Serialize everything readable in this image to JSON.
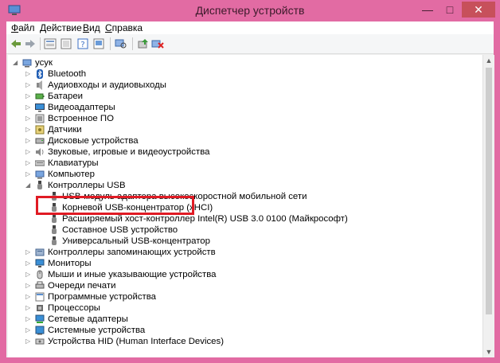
{
  "window": {
    "title": "Диспетчер устройств",
    "minimize": "—",
    "maximize": "□",
    "close": "✕"
  },
  "menu": [
    {
      "accel": "Ф",
      "rest": "айл"
    },
    {
      "accel": "Д",
      "rest": "ействие"
    },
    {
      "accel": "В",
      "rest": "ид"
    },
    {
      "accel": "С",
      "rest": "правка"
    }
  ],
  "toolbar": [
    "back-icon",
    "forward-icon",
    "properties-view-icon",
    "help-icon",
    "properties-icon",
    "monitor-icon",
    "scan-hardware-icon",
    "update-driver-icon",
    "remove-device-icon"
  ],
  "tree": {
    "root": "усук",
    "categories": [
      "Bluetooth",
      "Аудиовходы и аудиовыходы",
      "Батареи",
      "Видеоадаптеры",
      "Встроенное ПО",
      "Датчики",
      "Дисковые устройства",
      "Звуковые, игровые и видеоустройства",
      "Клавиатуры",
      "Компьютер",
      "Контроллеры USB",
      "Контроллеры запоминающих устройств",
      "Мониторы",
      "Мыши и иные указывающие устройства",
      "Очереди печати",
      "Программные устройства",
      "Процессоры",
      "Сетевые адаптеры",
      "Системные устройства",
      "Устройства HID (Human Interface Devices)"
    ],
    "usb_children": [
      "USB-модуль адаптера высокоскоростной мобильной сети",
      "Корневой USB-концентратор (xHCI)",
      "Расширяемый хост-контроллер Intel(R) USB 3.0 0100 (Майкрософт)",
      "Составное USB устройство",
      "Универсальный USB-концентратор"
    ]
  },
  "colors": {
    "frame": "#e26ba3",
    "selection": "#cce8ff",
    "highlight_box": "#e01b24"
  }
}
